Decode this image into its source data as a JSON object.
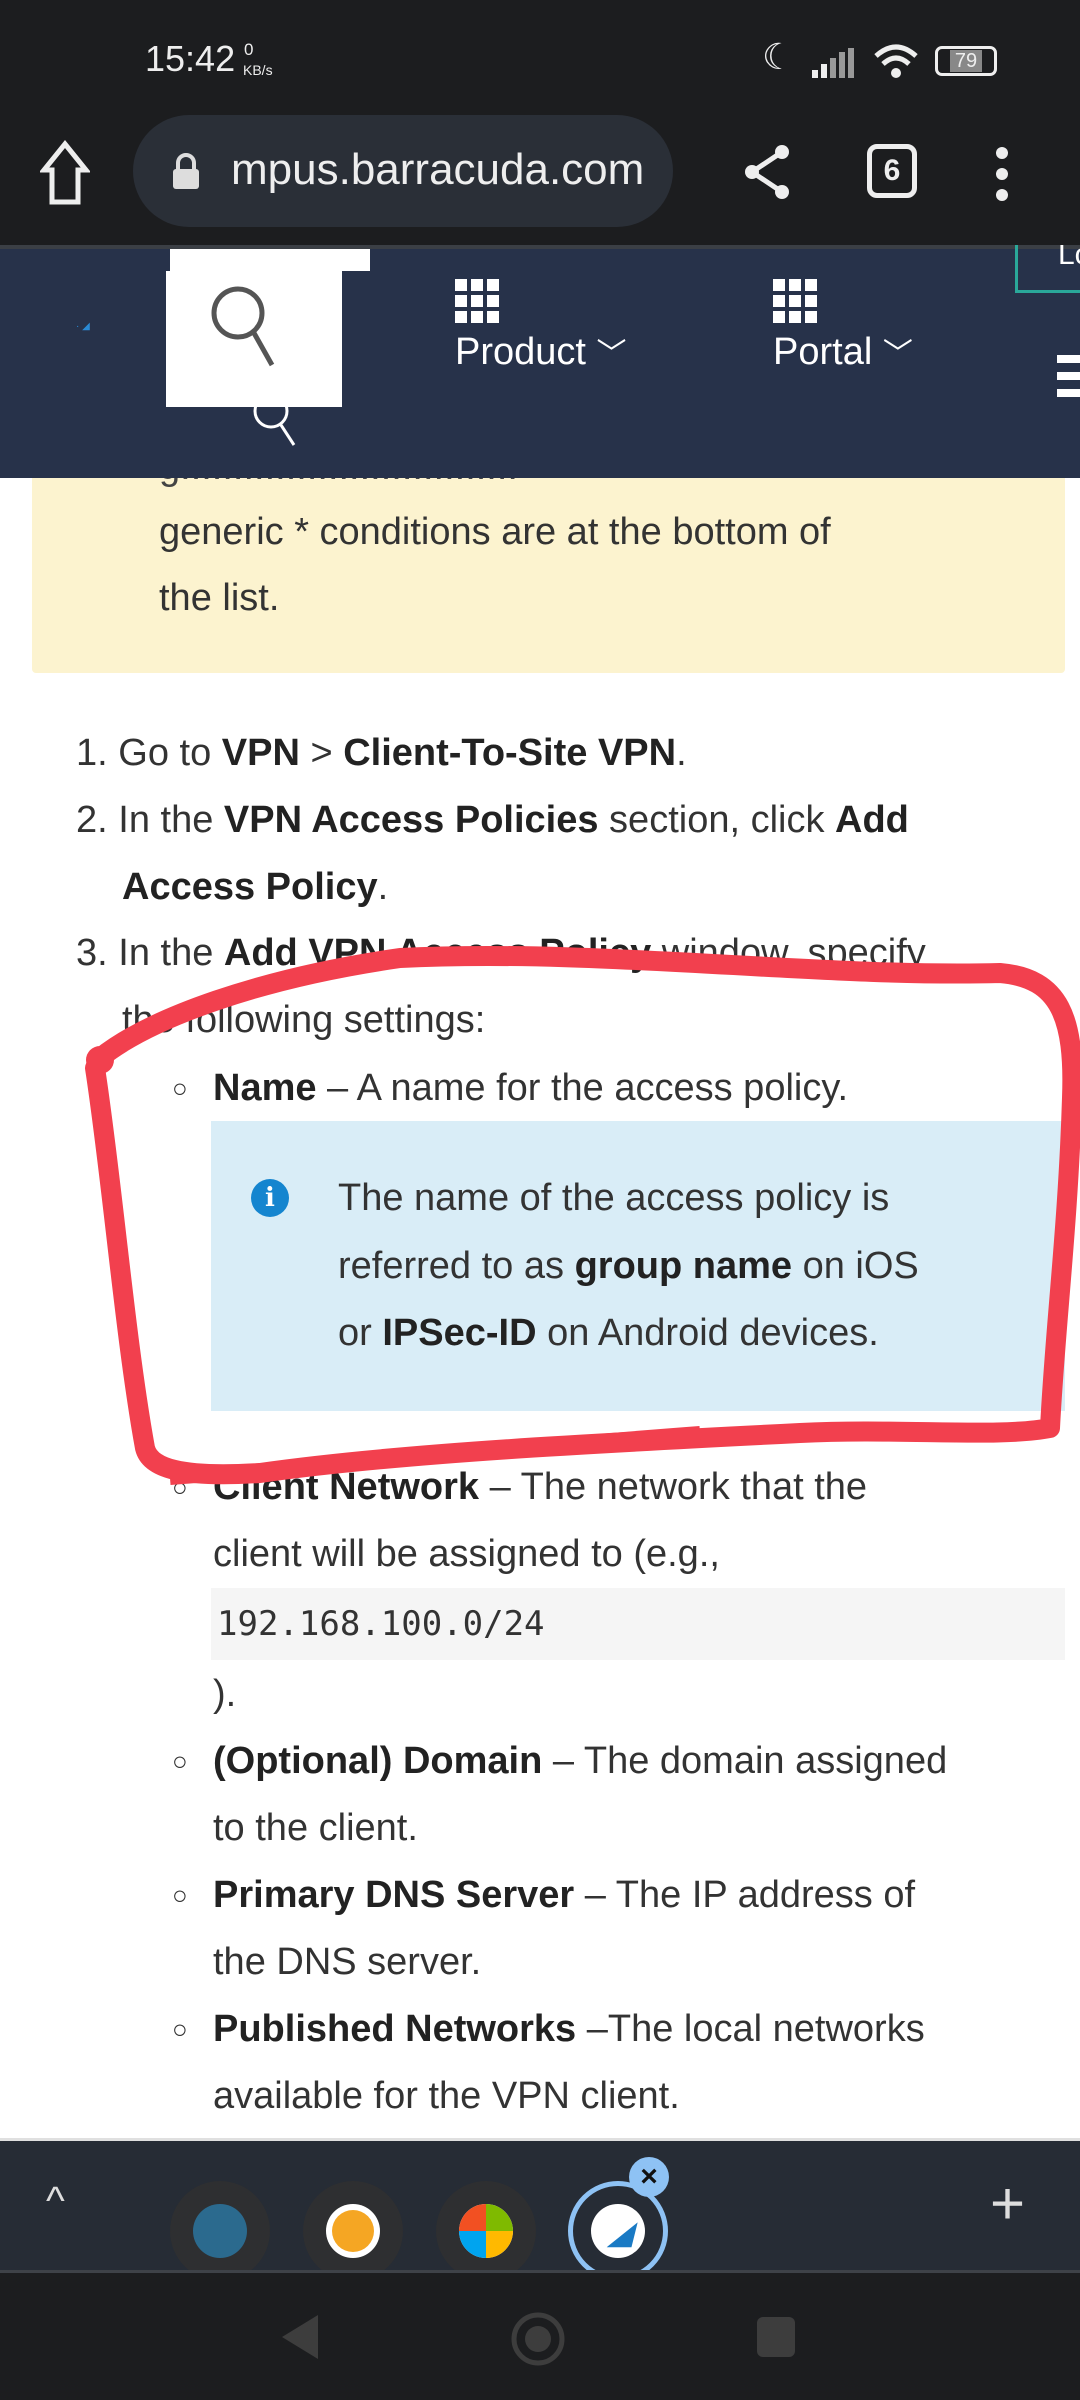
{
  "status_bar": {
    "time": "15:42",
    "net_speed_value": "0",
    "net_speed_unit": "KB/s",
    "battery": "79",
    "icons": [
      "moon-icon",
      "signal-icon",
      "wifi-icon",
      "battery-icon"
    ]
  },
  "browser": {
    "url": "mpus.barracuda.com",
    "tab_count": "6"
  },
  "site_nav": {
    "product_label": "Product",
    "portal_label": "Portal",
    "login_partial": "Lo"
  },
  "content": {
    "note_lines": [
      "generic * conditions are at the bottom of",
      "the list."
    ],
    "steps": [
      {
        "num": "1.",
        "parts": [
          "Go to ",
          "VPN",
          " > ",
          "Client-To-Site VPN",
          "."
        ]
      },
      {
        "num": "2.",
        "parts": [
          "In the ",
          "VPN Access Policies",
          " section, click ",
          "Add"
        ],
        "cont": [
          "Access Policy",
          "."
        ]
      },
      {
        "num": "3.",
        "parts": [
          "In the ",
          "Add VPN Access Policy",
          " window, specify"
        ],
        "cont": [
          "the following settings:"
        ]
      }
    ],
    "settings": [
      {
        "term": "Name",
        "desc": " – A name for the access policy."
      },
      {
        "term": "Client Network",
        "desc": " – The network that the",
        "cont": "client will be assigned to (e.g.,",
        "code": "192.168.100.0/24",
        "after": ")."
      },
      {
        "term": "(Optional) Domain",
        "desc": " – The domain assigned",
        "cont": "to the client."
      },
      {
        "term": "Primary DNS Server",
        "desc": " – The IP address of",
        "cont": "the DNS server."
      },
      {
        "term": "Published Networks",
        "desc": " –The local networks",
        "cont": "available for the VPN client."
      }
    ],
    "info": {
      "l1": "The name of the access policy is",
      "l2a": "referred to as ",
      "l2b": "group name",
      " l2c": "",
      "l2d": " on iOS",
      "l3a": "or ",
      "l3b": "IPSec-ID",
      "l3c": " on Android devices."
    }
  },
  "colors": {
    "annotation": "#f2404e",
    "nav_bg": "#27324a",
    "info_bg": "#d9edf7",
    "note_bg": "#fcf3cf"
  }
}
